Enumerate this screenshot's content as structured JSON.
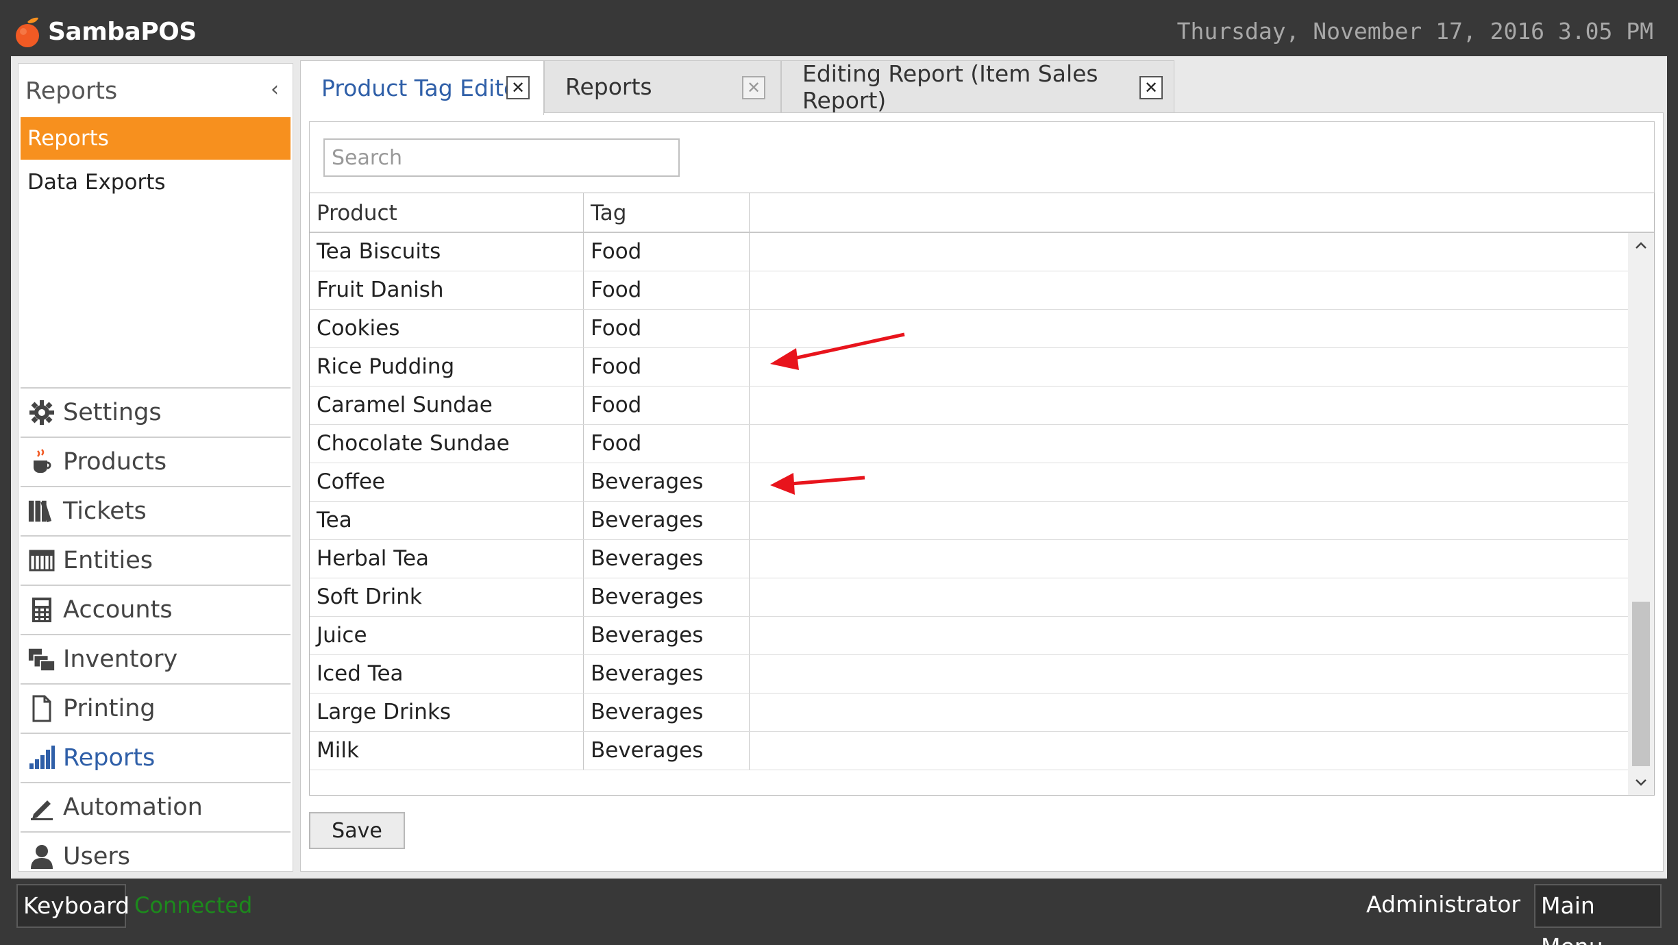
{
  "app": {
    "name": "SambaPOS",
    "datetime": "Thursday, November 17, 2016 3.05 PM"
  },
  "sidebar": {
    "title": "Reports",
    "collapse_glyph": "‹",
    "sub_items": [
      {
        "label": "Reports",
        "active": true
      },
      {
        "label": "Data Exports",
        "active": false
      }
    ],
    "nav": [
      {
        "label": "Settings",
        "icon": "gear-icon"
      },
      {
        "label": "Products",
        "icon": "coffee-cup-icon"
      },
      {
        "label": "Tickets",
        "icon": "books-icon"
      },
      {
        "label": "Entities",
        "icon": "grid-table-icon"
      },
      {
        "label": "Accounts",
        "icon": "calculator-icon"
      },
      {
        "label": "Inventory",
        "icon": "stacked-boxes-icon"
      },
      {
        "label": "Printing",
        "icon": "document-icon"
      },
      {
        "label": "Reports",
        "icon": "bar-chart-icon",
        "selected": true
      },
      {
        "label": "Automation",
        "icon": "pencil-icon"
      },
      {
        "label": "Users",
        "icon": "user-icon"
      }
    ]
  },
  "tabs": [
    {
      "label": "Product Tag Editor",
      "active": true,
      "close": "✕"
    },
    {
      "label": "Reports",
      "active": false,
      "close": "✕"
    },
    {
      "label": "Editing Report (Item Sales Report)",
      "active": false,
      "close": "✕"
    }
  ],
  "search": {
    "placeholder": "Search",
    "value": ""
  },
  "grid": {
    "columns": [
      "Product",
      "Tag",
      ""
    ],
    "rows": [
      {
        "product": "Tea Biscuits",
        "tag": "Food"
      },
      {
        "product": "Fruit Danish",
        "tag": "Food"
      },
      {
        "product": "Cookies",
        "tag": "Food"
      },
      {
        "product": "Rice Pudding",
        "tag": "Food"
      },
      {
        "product": "Caramel Sundae",
        "tag": "Food"
      },
      {
        "product": "Chocolate Sundae",
        "tag": "Food"
      },
      {
        "product": "Coffee",
        "tag": "Beverages"
      },
      {
        "product": "Tea",
        "tag": "Beverages"
      },
      {
        "product": "Herbal Tea",
        "tag": "Beverages"
      },
      {
        "product": "Soft Drink",
        "tag": "Beverages"
      },
      {
        "product": "Juice",
        "tag": "Beverages"
      },
      {
        "product": "Iced Tea",
        "tag": "Beverages"
      },
      {
        "product": "Large Drinks",
        "tag": "Beverages"
      },
      {
        "product": "Milk",
        "tag": "Beverages"
      }
    ]
  },
  "save_label": "Save",
  "footer": {
    "keyboard_label": "Keyboard",
    "status": "Connected",
    "user": "Administrator",
    "main_menu_label": "Main Menu"
  },
  "colors": {
    "accent": "#f7901e",
    "status_ok": "#1c8a1c",
    "annotation": "#e8141c",
    "selected_nav": "#2f5fa8"
  }
}
